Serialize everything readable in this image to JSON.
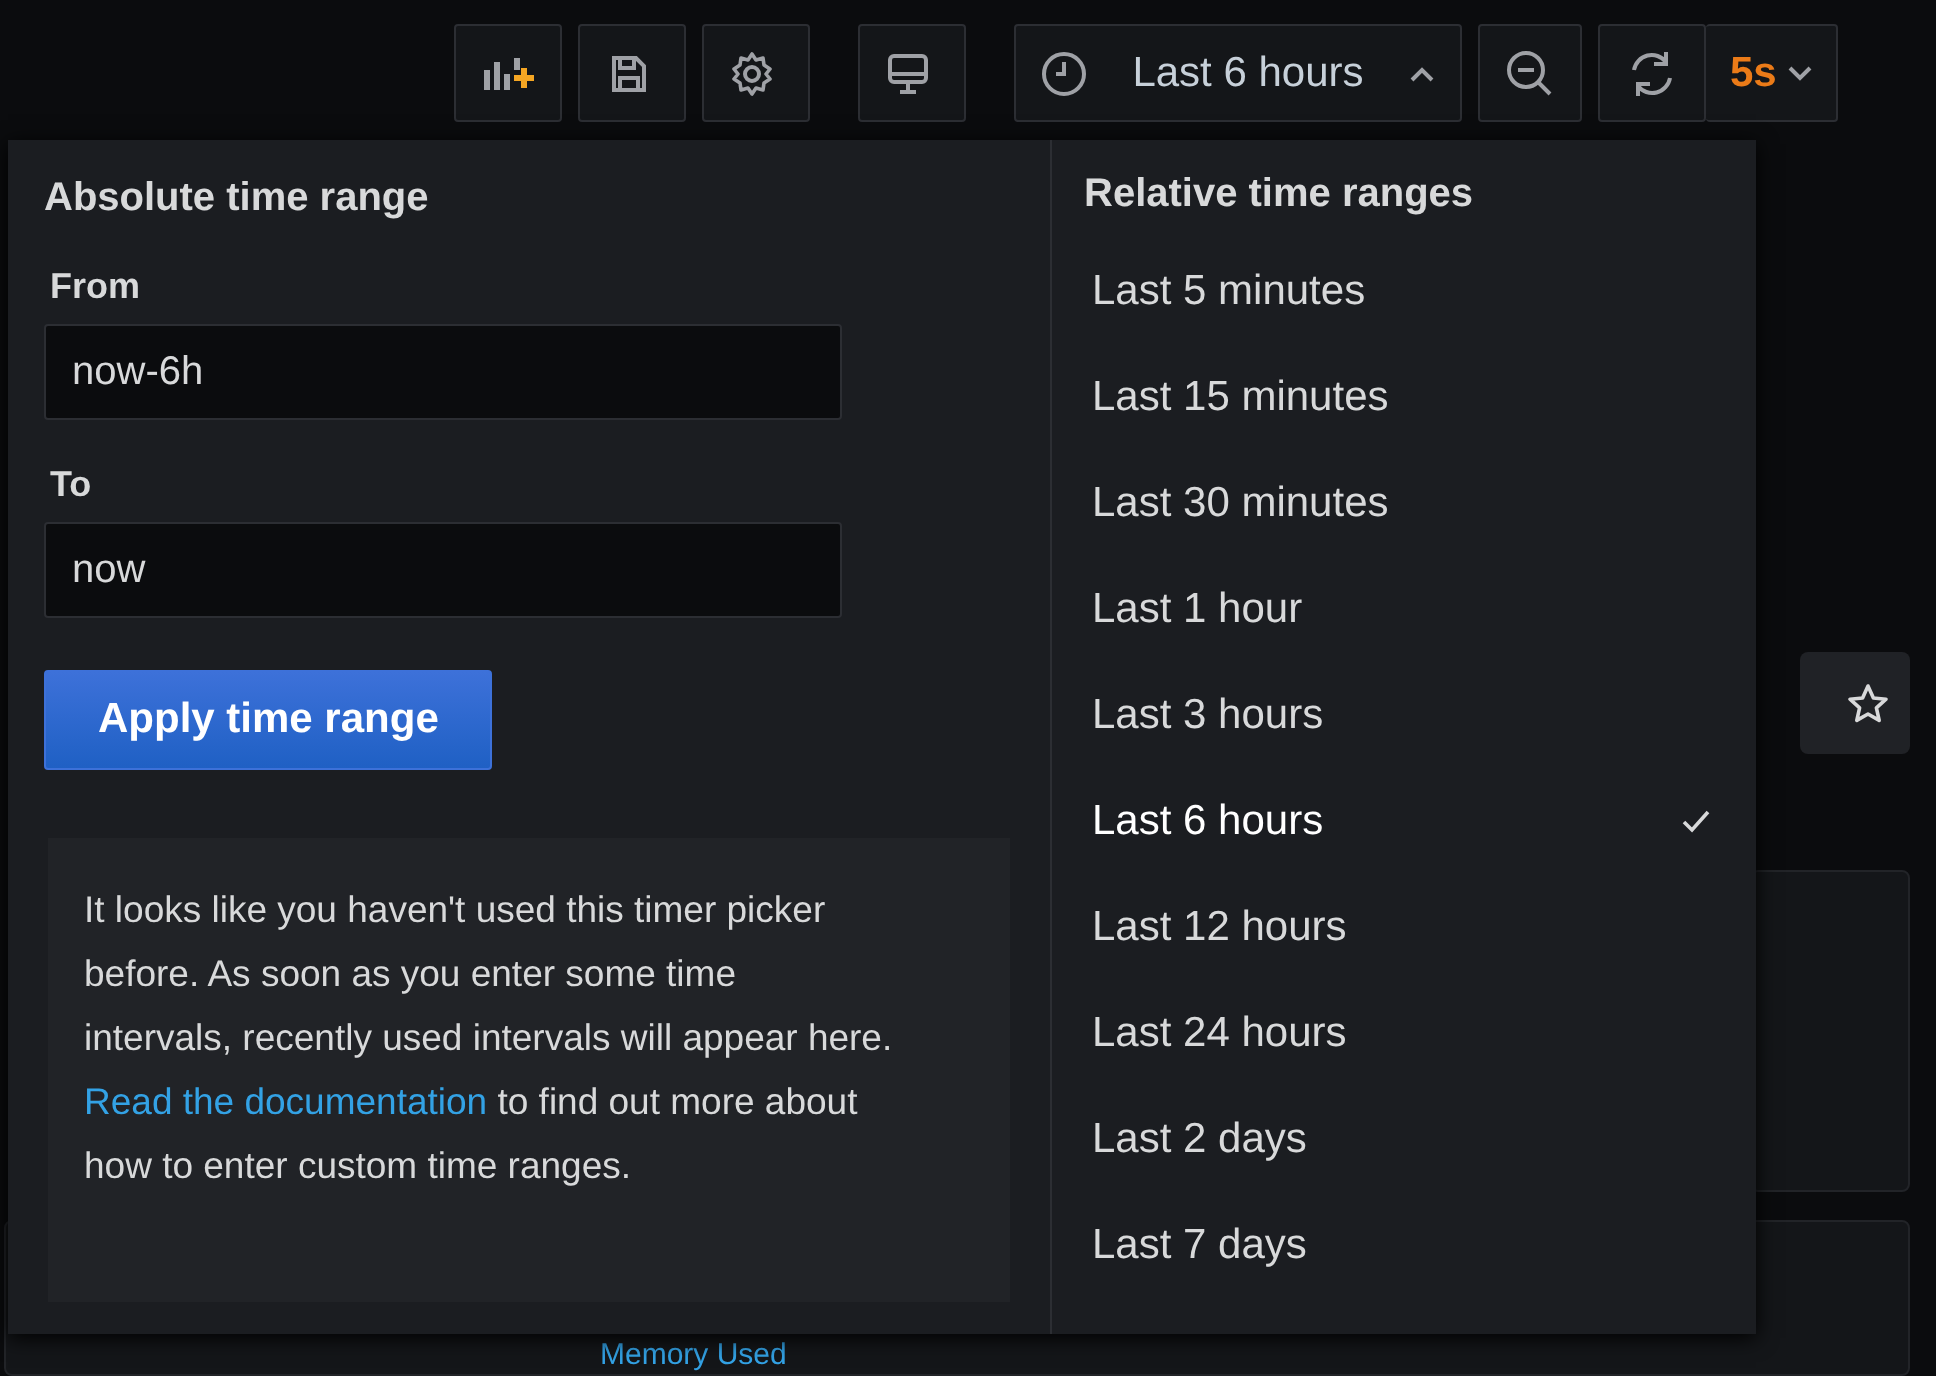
{
  "toolbar": {
    "icon_buttons": [
      {
        "kind": "add-panel"
      },
      {
        "kind": "save"
      },
      {
        "kind": "settings"
      },
      {
        "kind": "tv"
      }
    ],
    "time_picker": {
      "label": "Last 6 hours",
      "expanded": true
    },
    "refresh_interval": "5s"
  },
  "time_picker_popup": {
    "absolute": {
      "title": "Absolute time range",
      "from_label": "From",
      "from_value": "now-6h",
      "to_label": "To",
      "to_value": "now",
      "apply_button": "Apply time range",
      "info_text": "It looks like you haven't used this timer picker before. As soon as you enter some time intervals, recently used intervals will appear here.",
      "info_link": "Read the documentation",
      "info_text_after": "to find out more about how to enter custom time ranges."
    },
    "relative": {
      "title": "Relative time ranges",
      "options": [
        {
          "label": "Last 5 minutes",
          "selected": false
        },
        {
          "label": "Last 15 minutes",
          "selected": false
        },
        {
          "label": "Last 30 minutes",
          "selected": false
        },
        {
          "label": "Last 1 hour",
          "selected": false
        },
        {
          "label": "Last 3 hours",
          "selected": false
        },
        {
          "label": "Last 6 hours",
          "selected": true
        },
        {
          "label": "Last 12 hours",
          "selected": false
        },
        {
          "label": "Last 24 hours",
          "selected": false
        },
        {
          "label": "Last 2 days",
          "selected": false
        },
        {
          "label": "Last 7 days",
          "selected": false
        }
      ]
    }
  },
  "background_panel": {
    "title": "Memory Used"
  }
}
